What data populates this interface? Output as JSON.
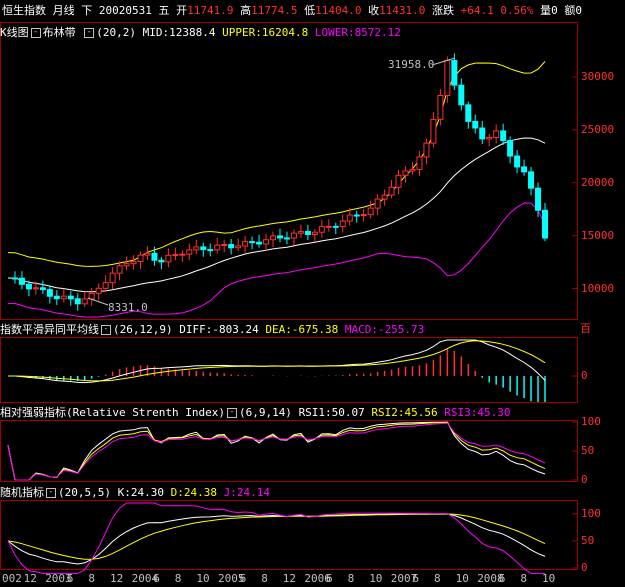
{
  "header": {
    "name": "恒生指数",
    "period": "月线",
    "direction": "下",
    "date": "20020531",
    "weekday": "五",
    "open_label": "开",
    "open": "11741.9",
    "high_label": "高",
    "high": "11774.5",
    "low_label": "低",
    "low": "11404.0",
    "close_label": "收",
    "close": "11431.0",
    "chg_label": "涨跌",
    "chg": "+64.1",
    "pct": "0.56%",
    "vol_label": "量0",
    "amt_label": "额0"
  },
  "main": {
    "title": "K线图",
    "indicator": "布林带",
    "params": "(20,2)",
    "mid_label": "MID:12388.4",
    "upper_label": "UPPER:16204.8",
    "lower_label": "LOWER:8572.12",
    "high_marker": "31958.0",
    "low_marker": "8331.0",
    "y_ticks": [
      "30000",
      "25000",
      "20000",
      "15000",
      "10000"
    ],
    "right_label": "百"
  },
  "macd": {
    "title": "指数平滑异同平均线",
    "params": "(26,12,9)",
    "diff": "DIFF:-803.24",
    "dea": "DEA:-675.38",
    "macd": "MACD:-255.73",
    "y_ticks": [
      "0"
    ]
  },
  "rsi": {
    "title": "相对强弱指标(Relative Strenth Index)",
    "params": "(6,9,14)",
    "rsi1": "RSI1:50.07",
    "rsi2": "RSI2:45.56",
    "rsi3": "RSI3:45.30",
    "y_ticks": [
      "100",
      "50",
      "0"
    ]
  },
  "kdj": {
    "title": "随机指标",
    "params": "(20,5,5)",
    "k": "K:24.30",
    "d": "D:24.38",
    "j": "J:24.14",
    "y_ticks": [
      "100",
      "50",
      "0"
    ]
  },
  "x_axis": {
    "labels": [
      {
        "t": "002"
      },
      {
        "t": "12"
      },
      {
        "t": "2003"
      },
      {
        "t": "6"
      },
      {
        "t": "8"
      },
      {
        "t": "12"
      },
      {
        "t": "2004"
      },
      {
        "t": "6"
      },
      {
        "t": "8"
      },
      {
        "t": "10"
      },
      {
        "t": "2005"
      },
      {
        "t": "6"
      },
      {
        "t": "8"
      },
      {
        "t": "12"
      },
      {
        "t": "2006"
      },
      {
        "t": "6"
      },
      {
        "t": "8"
      },
      {
        "t": "10"
      },
      {
        "t": "2007"
      },
      {
        "t": "6"
      },
      {
        "t": "8"
      },
      {
        "t": "10"
      },
      {
        "t": "2008"
      },
      {
        "t": "6"
      },
      {
        "t": "8"
      },
      {
        "t": "10"
      }
    ]
  },
  "colors": {
    "up": "#ff3030",
    "down": "#00ffff",
    "mid": "#ffffff",
    "upper": "#ffff00",
    "lower": "#ff00ff",
    "frame": "#a00000"
  }
}
